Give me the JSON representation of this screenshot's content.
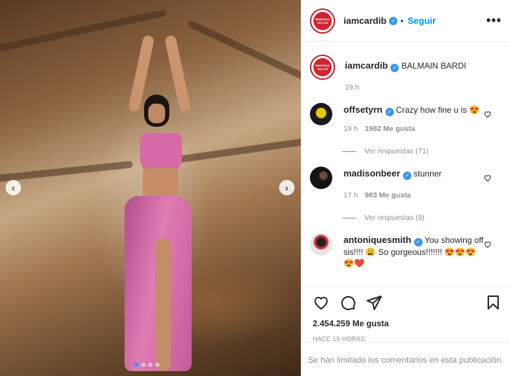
{
  "post": {
    "author": "iamcardib",
    "author_avatar_text": "BREONNA TAYLOR",
    "follow_label": "Seguir",
    "more_label": "•••",
    "caption": "BALMAIN BARDI",
    "caption_time": "19 h",
    "likes": "2.454.259 Me gusta",
    "posted_time": "HACE 19 HORAS",
    "comments_limited": "Se han limitado los comentarios en esta publicación.",
    "carousel": {
      "slide_count": 4,
      "active_index": 0,
      "prev_label": "‹",
      "next_label": "›"
    }
  },
  "comments": [
    {
      "user": "offsetyrn",
      "text": "Crazy how fine u is 😍",
      "time": "19 h",
      "likes": "1982 Me gusta",
      "replies": "Ver respuestas (71)"
    },
    {
      "user": "madisonbeer",
      "text": "stunner",
      "time": "17 h",
      "likes": "983 Me gusta",
      "replies": "Ver respuestas (9)"
    },
    {
      "user": "antoniquesmith",
      "text": "You showing off sis!!!! 😩 So gorgeous!!!!!!! 😍😍😍😍❤️"
    }
  ],
  "colors": {
    "accent_blue": "#0095f6",
    "verified_blue": "#3897f0",
    "carousel_active": "#2e9bf0",
    "muted": "#8e8e8e"
  }
}
